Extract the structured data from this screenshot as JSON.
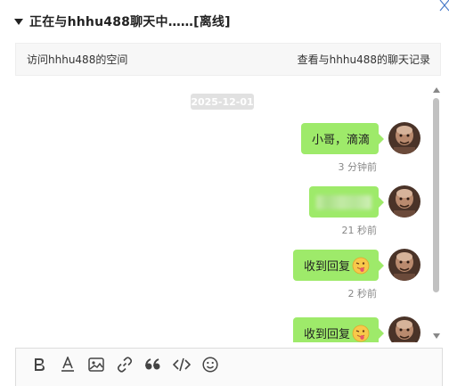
{
  "header": {
    "title": "正在与hhhu488聊天中……[离线]"
  },
  "subbar": {
    "visit_space": "访问hhhu488的空间",
    "view_history": "查看与hhhu488的聊天记录"
  },
  "chat": {
    "date": "2025-12-01",
    "messages": [
      {
        "text": "小哥，滴滴",
        "time": "3 分钟前"
      },
      {
        "text": "",
        "time": "21 秒前",
        "blurred": true
      },
      {
        "text": "收到回复",
        "time": "2 秒前",
        "emoji": "tongue-out-emoji"
      },
      {
        "text": "收到回复",
        "time": "",
        "emoji": "tongue-out-emoji"
      }
    ]
  },
  "toolbar": {
    "tools": [
      "bold-icon",
      "font-color-icon",
      "image-icon",
      "link-icon",
      "quote-icon",
      "code-icon",
      "emoji-icon"
    ]
  },
  "colors": {
    "bubble": "#9eea6a",
    "date_badge": "#e1e1e1",
    "subbar_bg": "#f7f7f7",
    "scroll_thumb": "#c1c1c1"
  }
}
